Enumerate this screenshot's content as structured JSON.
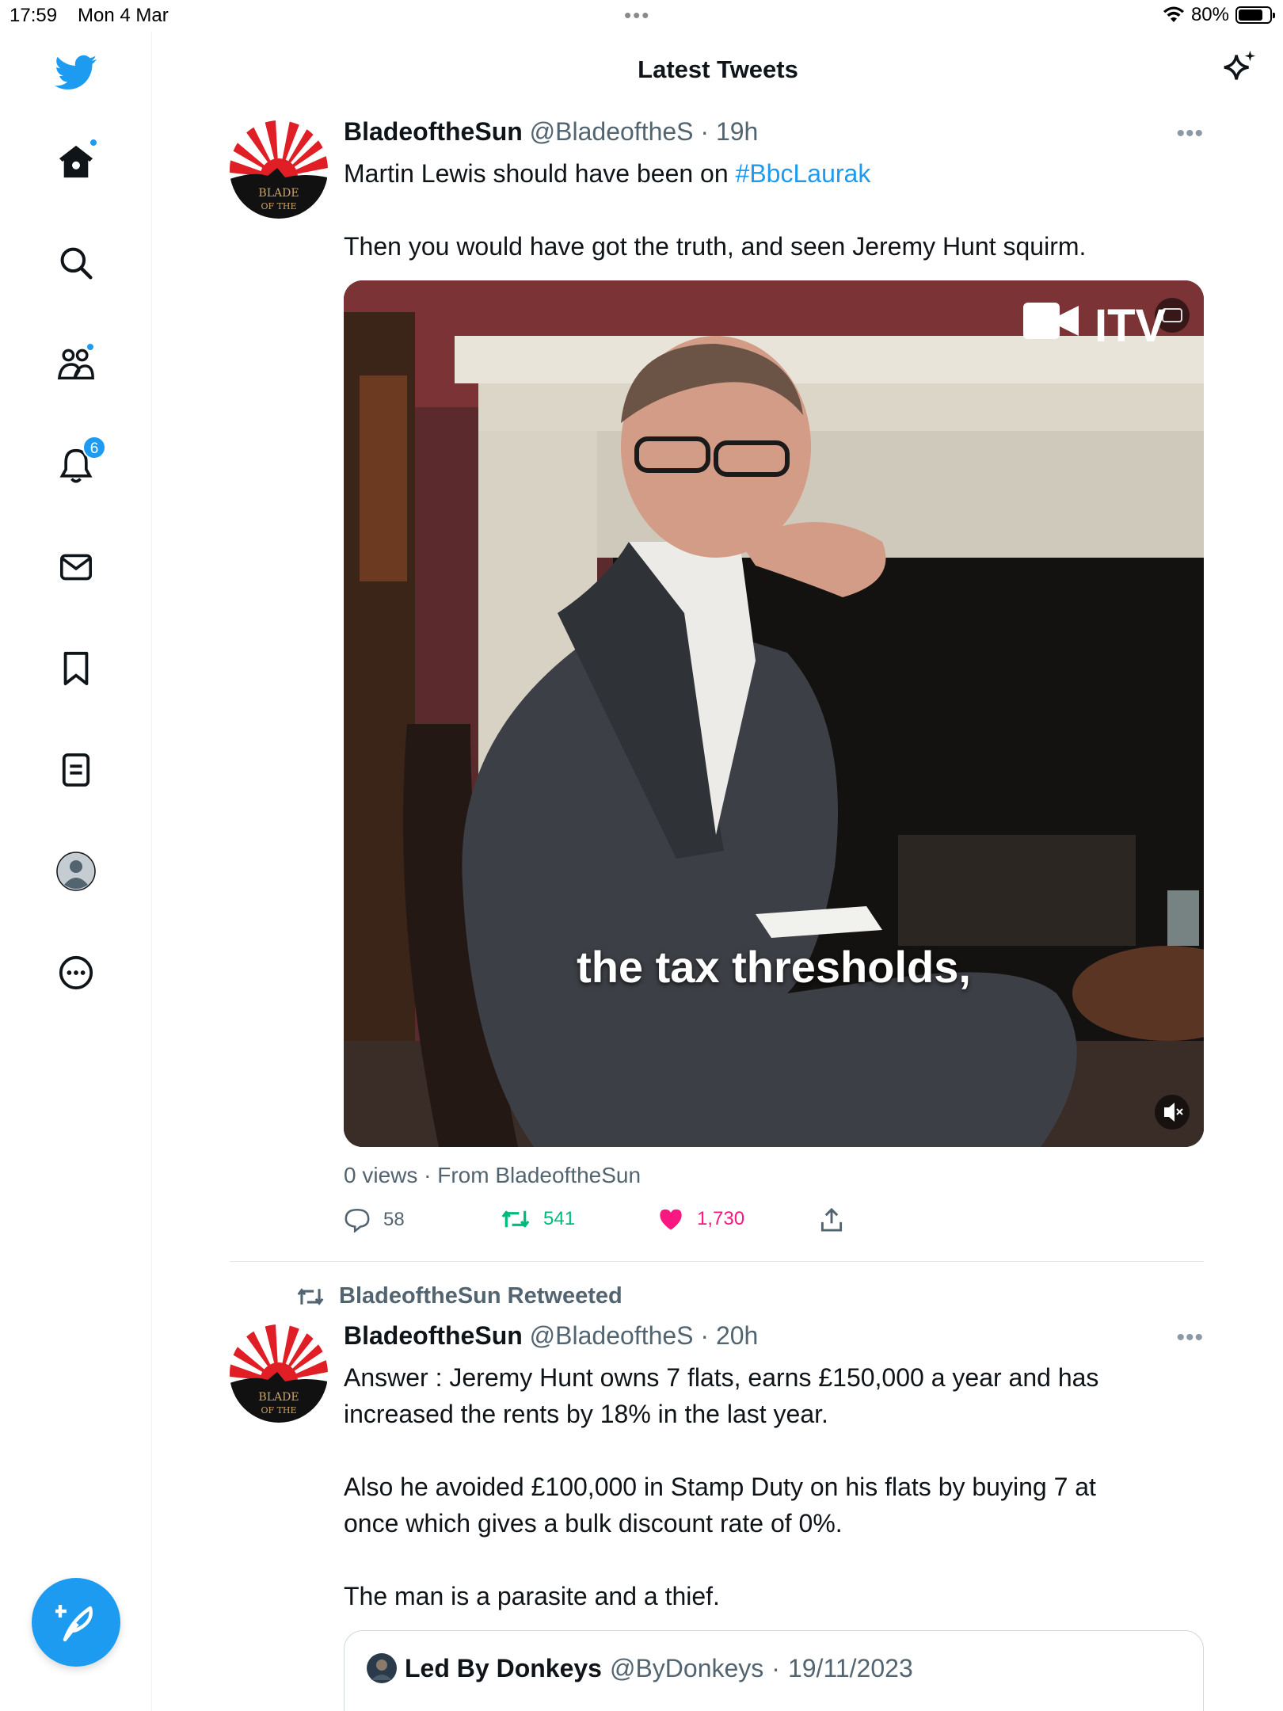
{
  "status_bar": {
    "time": "17:59",
    "date": "Mon 4 Mar",
    "battery": "80%",
    "battery_level": 0.8
  },
  "header": {
    "title": "Latest Tweets"
  },
  "sidebar": {
    "items": [
      {
        "name": "home",
        "icon": "home-icon",
        "has_dot": true
      },
      {
        "name": "explore",
        "icon": "search-icon"
      },
      {
        "name": "communities",
        "icon": "communities-icon",
        "has_dot": true
      },
      {
        "name": "notifications",
        "icon": "bell-icon",
        "badge": "6"
      },
      {
        "name": "messages",
        "icon": "mail-icon"
      },
      {
        "name": "bookmarks",
        "icon": "bookmark-icon"
      },
      {
        "name": "lists",
        "icon": "list-icon"
      },
      {
        "name": "profile",
        "icon": "avatar-icon"
      },
      {
        "name": "more",
        "icon": "more-circle-icon"
      }
    ]
  },
  "tweets": [
    {
      "name": "BladeoftheSun",
      "handle": "@BladeoftheS",
      "separator": "·",
      "time": "19h",
      "text_prefix": "Martin Lewis should have been on ",
      "hashtag": "#BbcLaurak",
      "text_2": "Then you would have got the truth, and seen Jeremy Hunt squirm.",
      "video": {
        "caption": "the tax thresholds,",
        "watermark": "ITV"
      },
      "views": "0 views · From BladeoftheSun",
      "replies": "58",
      "retweets": "541",
      "likes": "1,730"
    },
    {
      "retweeted_by": "BladeoftheSun Retweeted",
      "name": "BladeoftheSun",
      "handle": "@BladeoftheS",
      "separator": "·",
      "time": "20h",
      "line_1": "Answer : Jeremy Hunt owns 7 flats, earns £150,000 a year and has",
      "line_2": "increased the rents by 18% in the last year.",
      "line_3": "Also he avoided £100,000 in Stamp Duty on his flats by buying 7 at",
      "line_4": "once which gives a bulk discount rate of 0%.",
      "line_5": "The man is a parasite and a thief.",
      "quote": {
        "name": "Led By Donkeys",
        "handle": "@ByDonkeys",
        "separator": "·",
        "date": "19/11/2023"
      }
    }
  ],
  "colors": {
    "accent": "#1d9bf0",
    "retweet": "#00ba7c",
    "like": "#f91880",
    "secondary_text": "#536471"
  }
}
